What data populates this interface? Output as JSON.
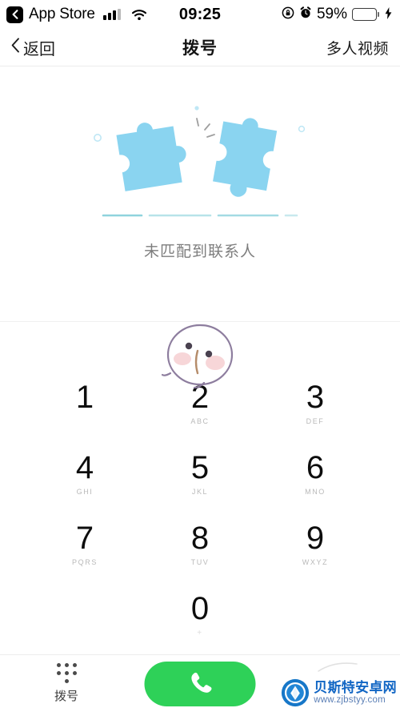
{
  "status_bar": {
    "back_label": "App Store",
    "back_icon": "chevron-left-icon",
    "signal_icon": "signal-bars-icon",
    "wifi_icon": "wifi-icon",
    "time": "09:25",
    "rotation_lock_icon": "rotation-lock-icon",
    "alarm_icon": "alarm-clock-icon",
    "battery_percent": "59%",
    "battery_level": 59,
    "charging_icon": "lightning-bolt-icon",
    "battery_color": "#3ad35e"
  },
  "nav_bar": {
    "back_icon": "chevron-left-icon",
    "back_label": "返回",
    "title": "拨号",
    "action_label": "多人视频"
  },
  "empty_state": {
    "illustration": "puzzle-pieces-icon",
    "puzzle_color": "#8ad4f0",
    "ground_line_color": "#a8dde6",
    "message": "未匹配到联系人"
  },
  "mascot": {
    "icon": "cartoon-bird-avatar-icon",
    "outline_color": "#8d7d9e",
    "blush_color": "#f3c9cc"
  },
  "keypad": {
    "keys": [
      {
        "digit": "1",
        "letters": ""
      },
      {
        "digit": "2",
        "letters": "ABC"
      },
      {
        "digit": "3",
        "letters": "DEF"
      },
      {
        "digit": "4",
        "letters": "GHI"
      },
      {
        "digit": "5",
        "letters": "JKL"
      },
      {
        "digit": "6",
        "letters": "MNO"
      },
      {
        "digit": "7",
        "letters": "PQRS"
      },
      {
        "digit": "8",
        "letters": "TUV"
      },
      {
        "digit": "9",
        "letters": "WXYZ"
      },
      {
        "digit": "0",
        "letters": "+"
      }
    ]
  },
  "bottom_bar": {
    "dialer_icon": "keypad-dots-icon",
    "dialer_label": "拨号",
    "call_button_icon": "phone-handset-icon",
    "call_button_color": "#2ed158"
  },
  "watermark": {
    "logo_icon": "shell-logo-icon",
    "site_name": "贝斯特安卓网",
    "site_url": "www.zjbstyy.com",
    "brand_color": "#1166c4"
  }
}
